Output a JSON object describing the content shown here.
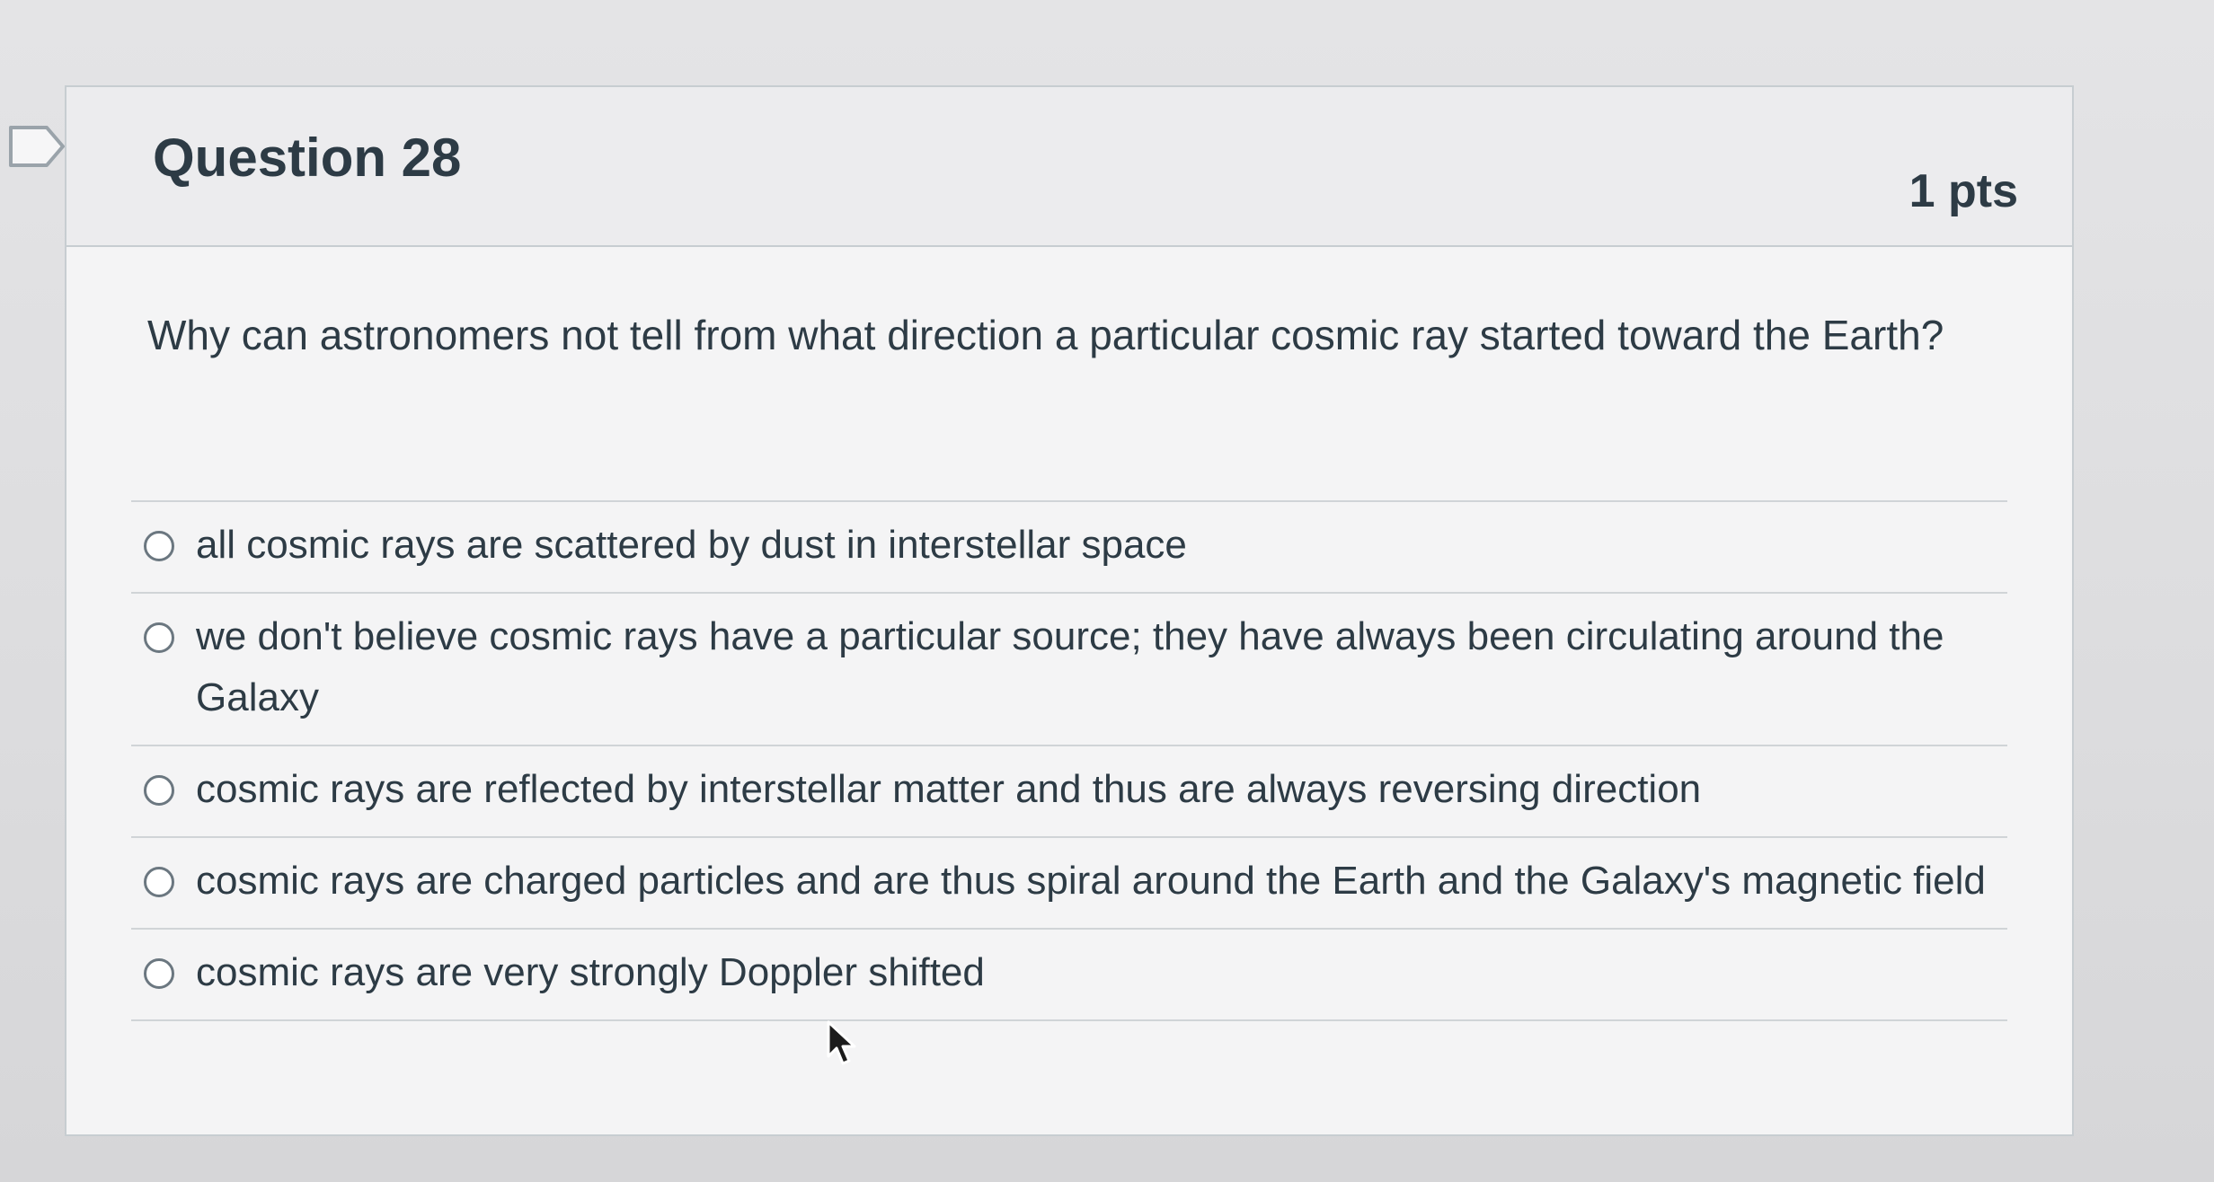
{
  "question": {
    "title": "Question 28",
    "points": "1 pts",
    "text": "Why can astronomers not tell from what direction a particular cosmic ray started toward the Earth?"
  },
  "answers": [
    {
      "label": "all cosmic rays are scattered by dust in interstellar space",
      "selected": false
    },
    {
      "label": "we don't believe cosmic rays have a particular source; they have always been circulating around the Galaxy",
      "selected": false
    },
    {
      "label": "cosmic rays are reflected by interstellar matter and thus are always reversing direction",
      "selected": false
    },
    {
      "label": "cosmic rays are charged particles and are thus spiral around the Earth and the Galaxy's magnetic field",
      "selected": false
    },
    {
      "label": "cosmic rays are very strongly Doppler shifted",
      "selected": false
    }
  ],
  "icons": {
    "flag": "flag-icon",
    "radio": "radio-button",
    "cursor": "mouse-pointer-icon"
  },
  "colors": {
    "text": "#2d3b45",
    "border": "#c7cdd1",
    "header_bg": "#ececee"
  }
}
